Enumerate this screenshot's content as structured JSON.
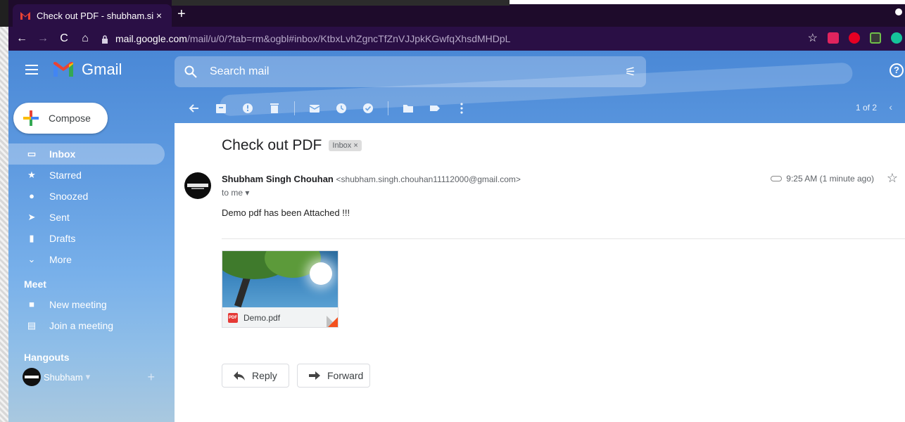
{
  "browser": {
    "tab_title": "Check out PDF - shubham.singh.",
    "tab_close": "×",
    "new_tab": "+",
    "url_host": "mail.google.com",
    "url_path": "/mail/u/0/?tab=rm&ogbl#inbox/KtbxLvhZgncTfZnVJJpkKGwfqXhsdMHDpL"
  },
  "gmail": {
    "app_name": "Gmail",
    "search_placeholder": "Search mail",
    "help": "?",
    "compose_label": "Compose",
    "nav": [
      {
        "label": "Inbox",
        "icon": "inbox-icon",
        "active": true
      },
      {
        "label": "Starred",
        "icon": "star-icon"
      },
      {
        "label": "Snoozed",
        "icon": "clock-icon"
      },
      {
        "label": "Sent",
        "icon": "send-icon"
      },
      {
        "label": "Drafts",
        "icon": "draft-icon"
      },
      {
        "label": "More",
        "icon": "chevron-down-icon"
      }
    ],
    "meet": {
      "title": "Meet",
      "items": [
        {
          "label": "New meeting",
          "icon": "video-icon"
        },
        {
          "label": "Join a meeting",
          "icon": "keyboard-icon"
        }
      ]
    },
    "hangouts": {
      "title": "Hangouts",
      "user": "Shubham"
    },
    "pager": "1 of 2",
    "accent": "#1a73e8"
  },
  "message": {
    "subject": "Check out PDF",
    "label": "Inbox",
    "label_close": "×",
    "sender_name": "Shubham Singh Chouhan",
    "sender_email": "<shubham.singh.chouhan11112000@gmail.com>",
    "to": "to me",
    "time": "9:25 AM (1 minute ago)",
    "body": "Demo pdf has been Attached !!!",
    "attachment": {
      "name": "Demo.pdf",
      "type": "PDF"
    },
    "reply_label": "Reply",
    "forward_label": "Forward"
  }
}
